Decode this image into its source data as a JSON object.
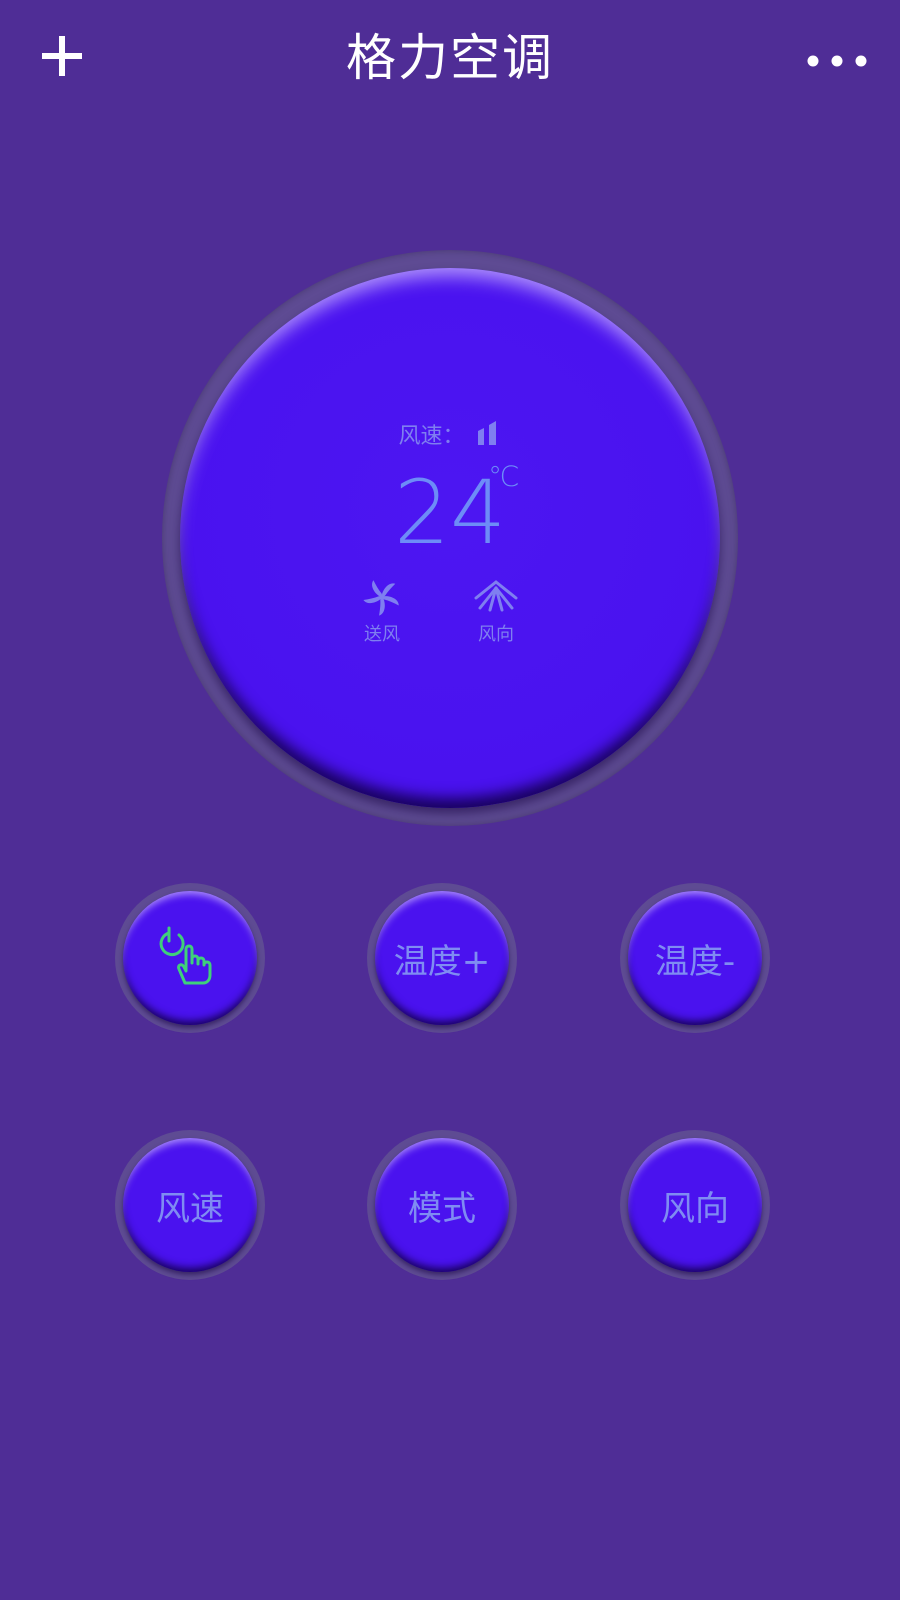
{
  "header": {
    "title": "格力空调",
    "add_icon": "plus-icon",
    "more_icon": "more-dots-icon"
  },
  "display": {
    "wind_speed_label": "风速：",
    "wind_speed_level": 2,
    "temperature": "24",
    "temperature_unit": "℃",
    "mode_label": "送风",
    "direction_label": "风向"
  },
  "buttons": {
    "power_icon": "power-touch-icon",
    "temp_up": "温度+",
    "temp_down": "温度-",
    "wind_speed": "风速",
    "mode": "模式",
    "wind_direction": "风向"
  },
  "colors": {
    "background": "#4f2d96",
    "button_face": "#4a12ef",
    "display_text": "#6d8cf7",
    "power_icon": "#3fd07a"
  }
}
